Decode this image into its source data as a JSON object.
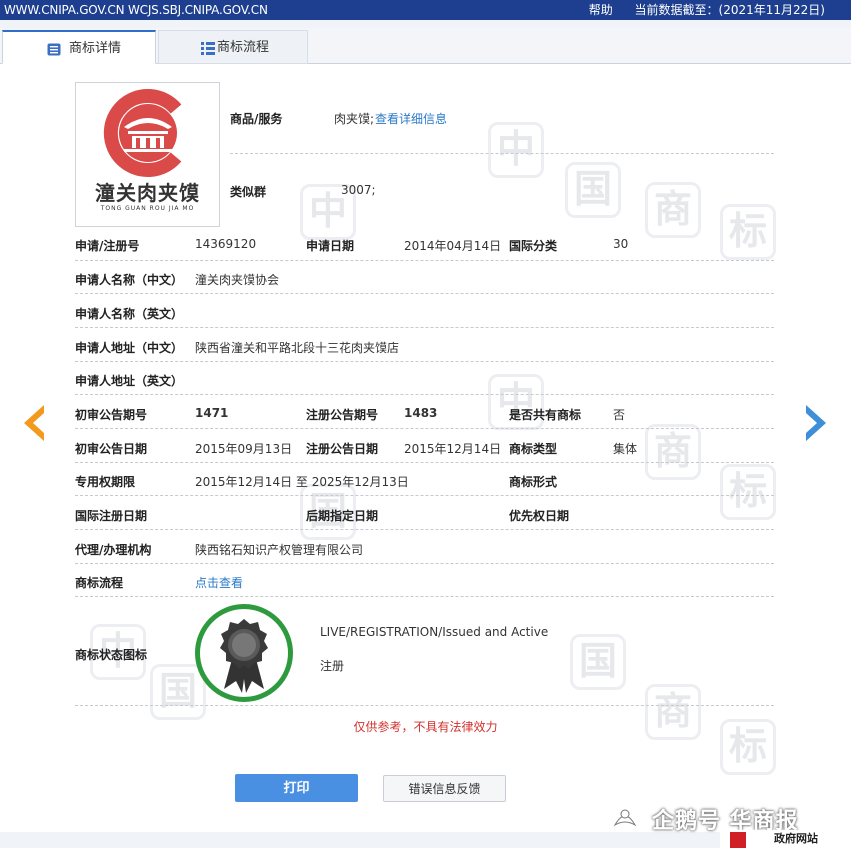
{
  "header": {
    "url_text": "WWW.CNIPA.GOV.CN WCJS.SBJ.CNIPA.GOV.CN",
    "help": "帮助",
    "data_date": "当前数据截至：(2021年11月22日)"
  },
  "tabs": [
    {
      "label": "商标详情",
      "icon": "document-list-icon",
      "active": true
    },
    {
      "label": "商标流程",
      "icon": "list-icon",
      "active": false
    }
  ],
  "logo": {
    "text": "潼关肉夹馍",
    "subtext": "TONG GUAN ROU JIA MO",
    "color": "#d94a49"
  },
  "fields": {
    "goods_label": "商品/服务",
    "goods_value": "肉夹馍;",
    "goods_link": "查看详细信息",
    "similar_label": "类似群",
    "similar_value": "3007;",
    "reg_no_label": "申请/注册号",
    "reg_no_value": "14369120",
    "app_date_label": "申请日期",
    "app_date_value": "2014年04月14日",
    "intl_class_label": "国际分类",
    "intl_class_value": "30",
    "applicant_cn_label": "申请人名称（中文）",
    "applicant_cn_value": "潼关肉夹馍协会",
    "applicant_en_label": "申请人名称（英文）",
    "addr_cn_label": "申请人地址（中文）",
    "addr_cn_value": "陕西省潼关和平路北段十三花肉夹馍店",
    "addr_en_label": "申请人地址（英文）",
    "prelim_no_label": "初审公告期号",
    "prelim_no_value": "1471",
    "reg_pub_no_label": "注册公告期号",
    "reg_pub_no_value": "1483",
    "shared_label": "是否共有商标",
    "shared_value": "否",
    "prelim_date_label": "初审公告日期",
    "prelim_date_value": "2015年09月13日",
    "reg_pub_date_label": "注册公告日期",
    "reg_pub_date_value": "2015年12月14日",
    "type_label": "商标类型",
    "type_value": "集体",
    "term_label": "专用权期限",
    "term_value": "2015年12月14日 至 2025年12月13日",
    "form_label": "商标形式",
    "intl_reg_label": "国际注册日期",
    "later_label": "后期指定日期",
    "priority_label": "优先权日期",
    "agent_label": "代理/办理机构",
    "agent_value": "陕西铭石知识产权管理有限公司",
    "flow_label": "商标流程",
    "flow_link": "点击查看",
    "status_icon_label": "商标状态图标",
    "status_en": "LIVE/REGISTRATION/Issued and Active",
    "status_cn": "注册"
  },
  "disclaimer": "仅供参考，不具有法律效力",
  "buttons": {
    "print": "打印",
    "feedback": "错误信息反馈"
  },
  "watermark": {
    "glyphs": [
      "中",
      "国",
      "商",
      "标"
    ]
  },
  "footer": {
    "source": "企鹅号 华商报",
    "gov": "政府网站"
  },
  "colors": {
    "header": "#1e3f8f",
    "link": "#2a79c6",
    "warn": "#d2322d",
    "arrow_left": "#f39a1e",
    "arrow_right": "#3e8ed8",
    "badge": "#2e9a3e"
  }
}
